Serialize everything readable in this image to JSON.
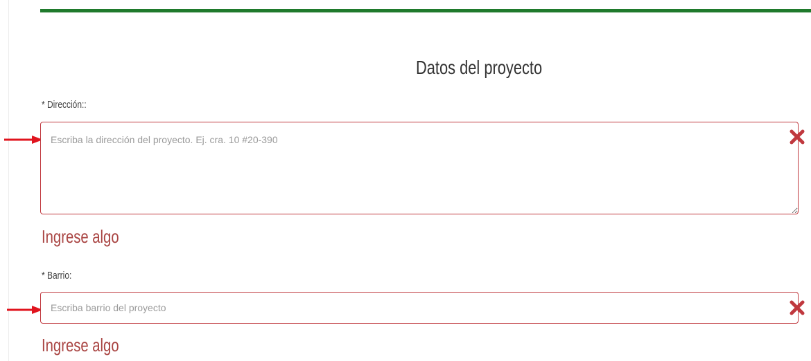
{
  "form": {
    "title": "Datos del proyecto",
    "fields": [
      {
        "label": "* Dirección::",
        "placeholder": "Escriba la dirección del proyecto. Ej. cra. 10 #20-390",
        "value": "",
        "error": "Ingrese algo"
      },
      {
        "label": "* Barrio:",
        "placeholder": "Escriba barrio del proyecto",
        "value": "",
        "error": "Ingrese algo"
      }
    ]
  },
  "icons": {
    "clear": "close-x-icon",
    "pointer": "red-arrow-icon"
  },
  "colors": {
    "accent_bar": "#1f7a2c",
    "error": "#c0383e",
    "error_text": "#a94442",
    "arrow": "#e0141e"
  }
}
